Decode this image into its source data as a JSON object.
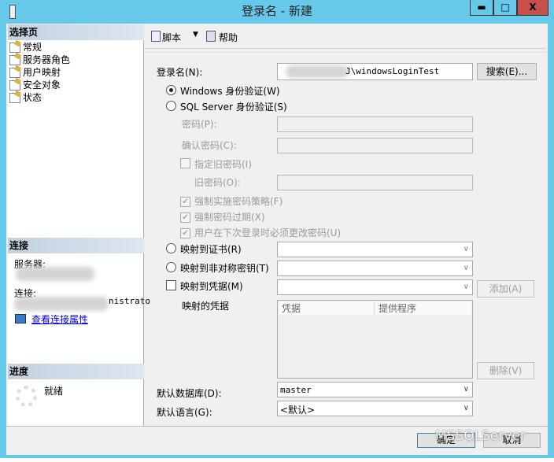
{
  "window": {
    "title": "登录名 - 新建",
    "minimize": "▬",
    "maximize": "□",
    "close": "X"
  },
  "left": {
    "select_page": "选择页",
    "pages": [
      "常规",
      "服务器角色",
      "用户映射",
      "安全对象",
      "状态"
    ],
    "connection": {
      "header": "连接",
      "server_label": "服务器:",
      "connection_label": "连接:",
      "connection_value_partial": "nistrato",
      "view_props": "查看连接属性"
    },
    "progress": {
      "header": "进度",
      "status": "就绪"
    }
  },
  "toolbar": {
    "script": "脚本",
    "help": "帮助"
  },
  "form": {
    "login_name_label": "登录名(N):",
    "login_name_value": "J\\windowsLoginTest",
    "search_button": "搜索(E)...",
    "windows_auth": "Windows 身份验证(W)",
    "sql_auth": "SQL Server 身份验证(S)",
    "password": "密码(P):",
    "confirm_password": "确认密码(C):",
    "specify_old": "指定旧密码(I)",
    "old_password": "旧密码(O):",
    "enforce_policy": "强制实施密码策略(F)",
    "enforce_expiration": "强制密码过期(X)",
    "must_change": "用户在下次登录时必须更改密码(U)",
    "map_cert": "映射到证书(R)",
    "map_asym": "映射到非对称密钥(T)",
    "map_cred": "映射到凭据(M)",
    "add_button": "添加(A)",
    "mapped_creds": "映射的凭据",
    "col_cred": "凭据",
    "col_provider": "提供程序",
    "remove_button": "删除(V)",
    "default_db_label": "默认数据库(D):",
    "default_db": "master",
    "default_lang_label": "默认语言(G):",
    "default_lang": "<默认>"
  },
  "footer": {
    "ok": "确定",
    "cancel": "取消",
    "watermark": "MSSQLServer"
  }
}
